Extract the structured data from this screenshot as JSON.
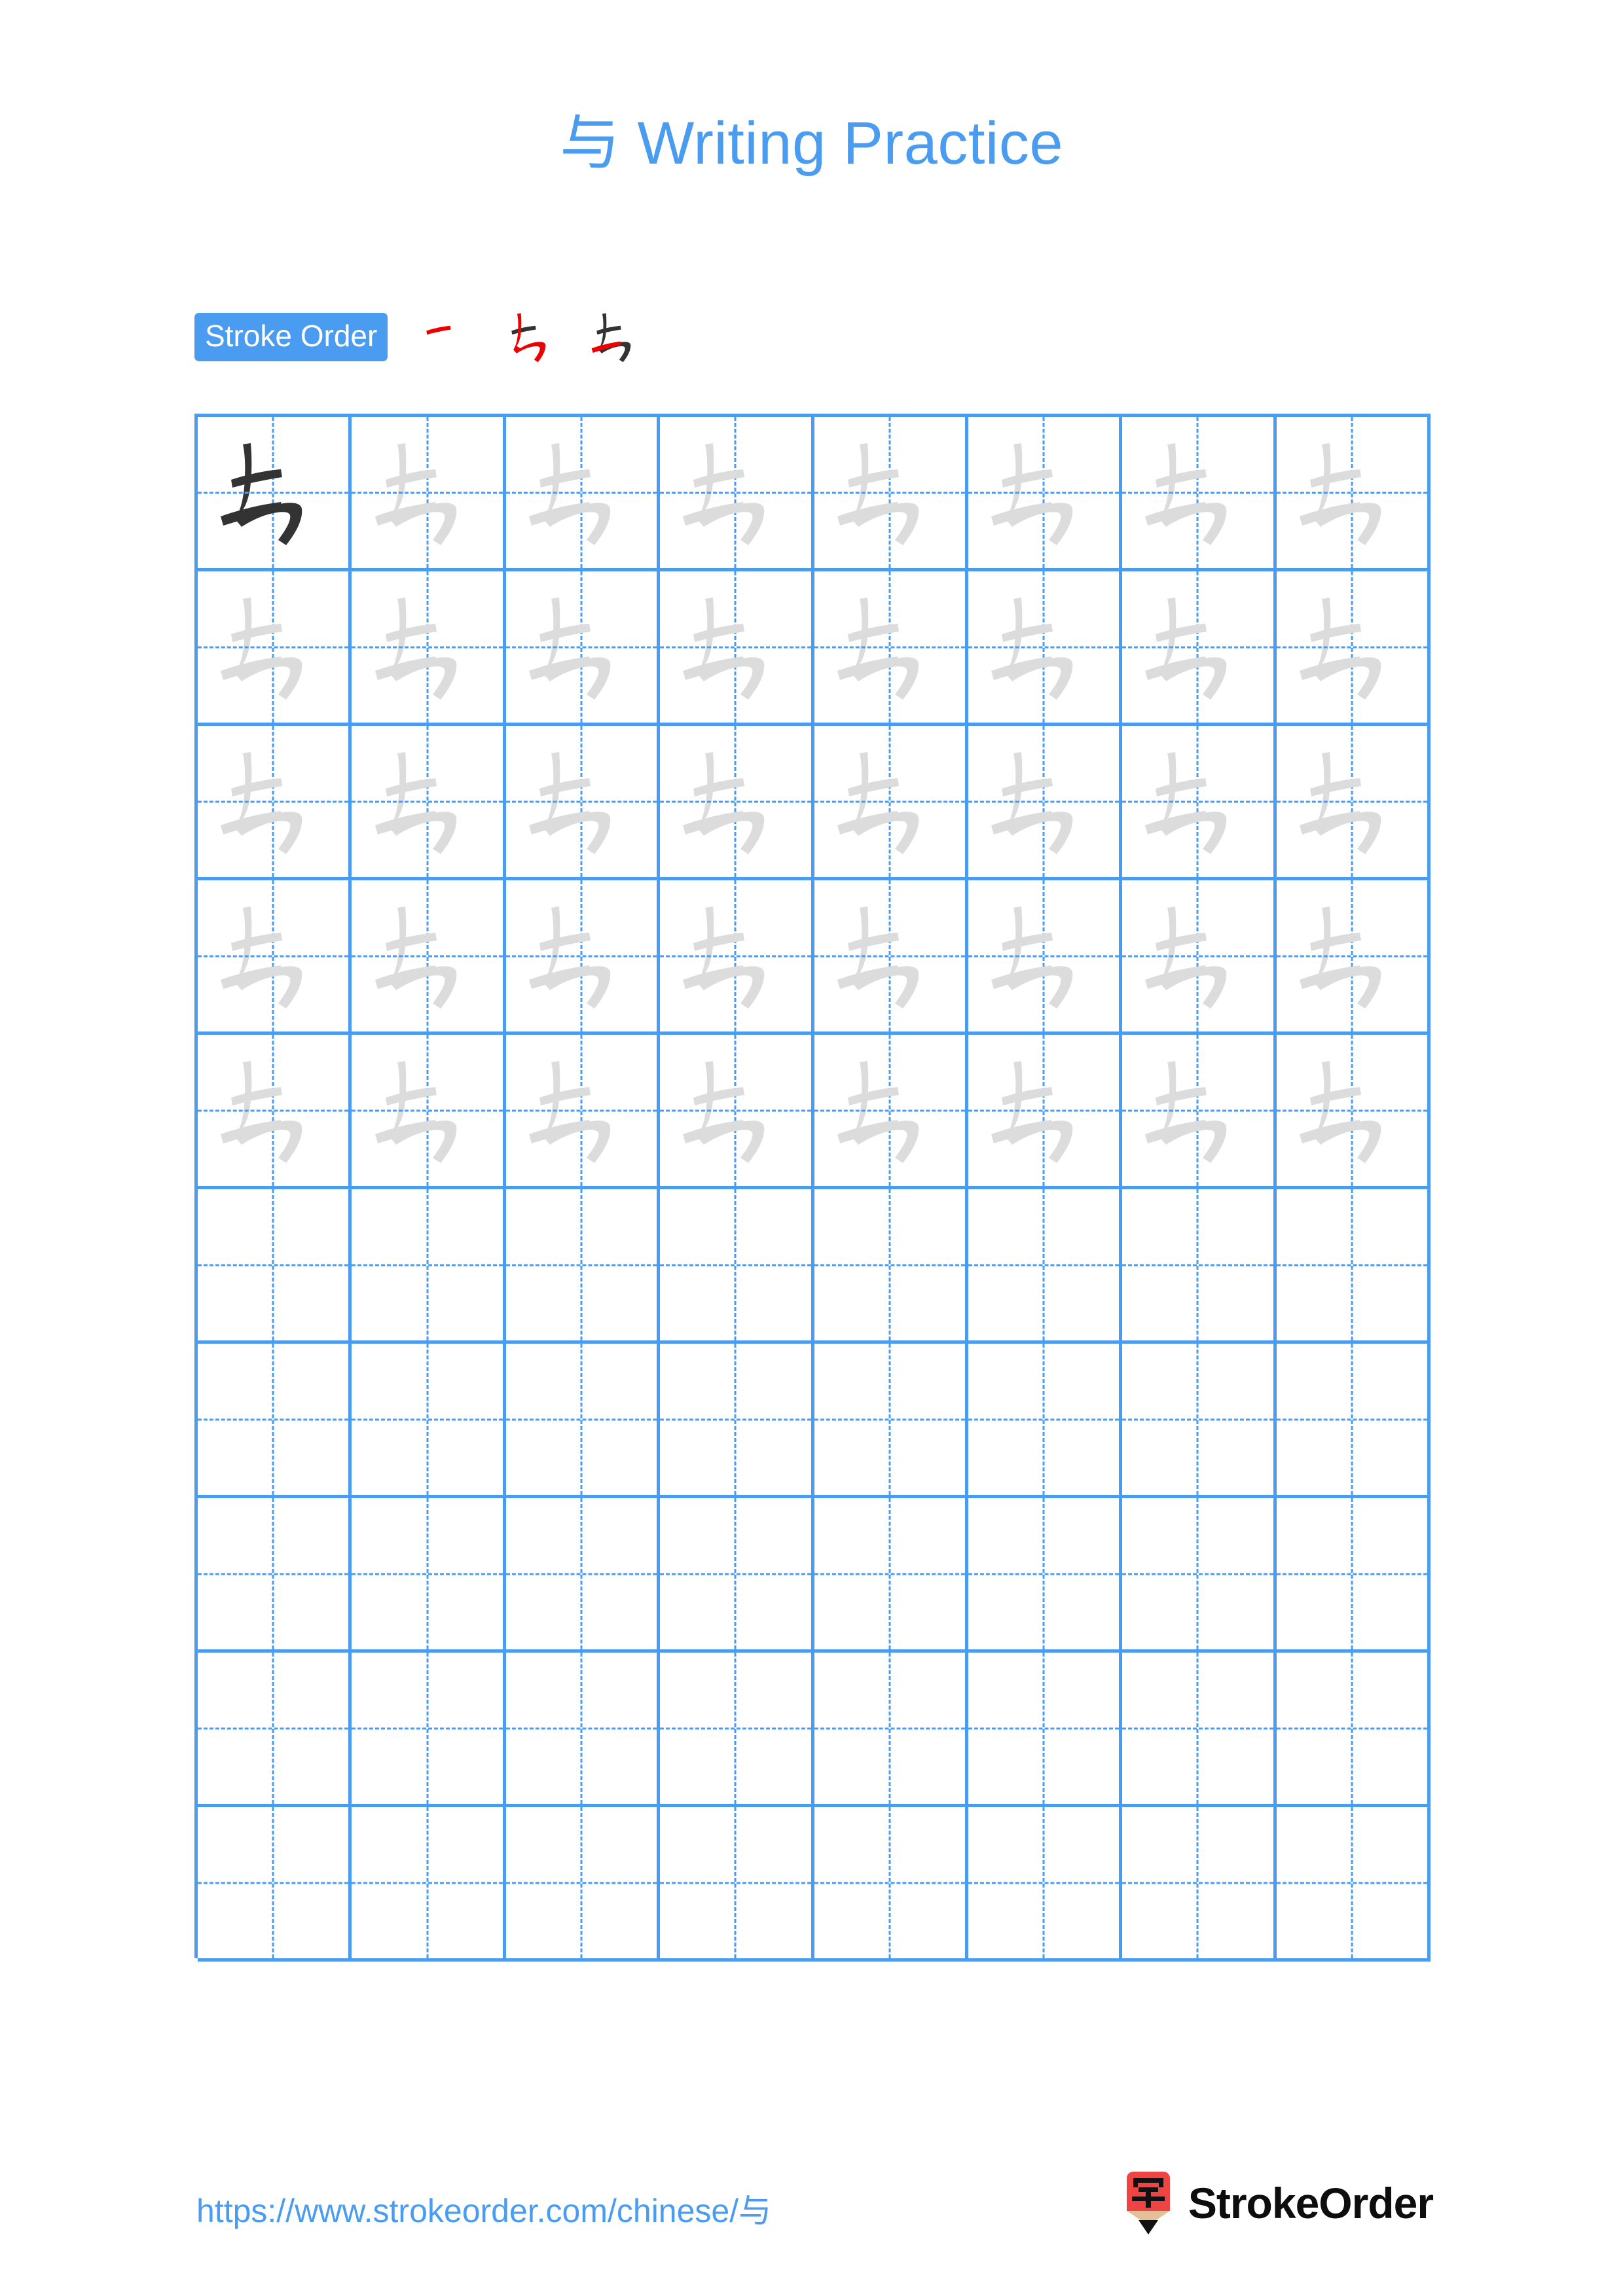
{
  "meta": {
    "character": "与",
    "colors": {
      "accent_blue": "#4a9cf0",
      "grid_blue": "#4a9cf0",
      "trace_gray": "#dcdcdc",
      "model_black": "#333333",
      "stroke_highlight_red": "#ee0000",
      "logo_red": "#ef4444",
      "logo_tan": "#e4c09a",
      "background": "#ffffff"
    }
  },
  "header": {
    "title_char": "与",
    "title_text": " Writing Practice"
  },
  "stroke_order": {
    "badge_label": "Stroke Order",
    "steps": [
      {
        "index": 1,
        "name": "stroke-step-1",
        "new_stroke": "heng",
        "new_stroke_color": "#ee0000"
      },
      {
        "index": 2,
        "name": "stroke-step-2",
        "new_stroke": "heng-zhe-zhe-gou",
        "new_stroke_color": "#ee0000"
      },
      {
        "index": 3,
        "name": "stroke-step-3",
        "new_stroke": "heng",
        "new_stroke_color": "#ee0000"
      }
    ],
    "total_strokes": 3
  },
  "practice_grid": {
    "columns": 8,
    "rows": 10,
    "total_cells": 80,
    "model_cells": 1,
    "trace_cells": 39,
    "blank_cells": 40,
    "cell_types": [
      "model",
      "trace",
      "trace",
      "trace",
      "trace",
      "trace",
      "trace",
      "trace",
      "trace",
      "trace",
      "trace",
      "trace",
      "trace",
      "trace",
      "trace",
      "trace",
      "trace",
      "trace",
      "trace",
      "trace",
      "trace",
      "trace",
      "trace",
      "trace",
      "trace",
      "trace",
      "trace",
      "trace",
      "trace",
      "trace",
      "trace",
      "trace",
      "trace",
      "trace",
      "trace",
      "trace",
      "trace",
      "trace",
      "trace",
      "trace",
      "blank",
      "blank",
      "blank",
      "blank",
      "blank",
      "blank",
      "blank",
      "blank",
      "blank",
      "blank",
      "blank",
      "blank",
      "blank",
      "blank",
      "blank",
      "blank",
      "blank",
      "blank",
      "blank",
      "blank",
      "blank",
      "blank",
      "blank",
      "blank",
      "blank",
      "blank",
      "blank",
      "blank",
      "blank",
      "blank",
      "blank",
      "blank",
      "blank",
      "blank",
      "blank",
      "blank",
      "blank",
      "blank",
      "blank",
      "blank"
    ]
  },
  "footer": {
    "url_prefix": "https://www.strokeorder.com/chinese/",
    "url_char": "与",
    "brand_name": "StrokeOrder",
    "brand_mark_char": "字"
  }
}
